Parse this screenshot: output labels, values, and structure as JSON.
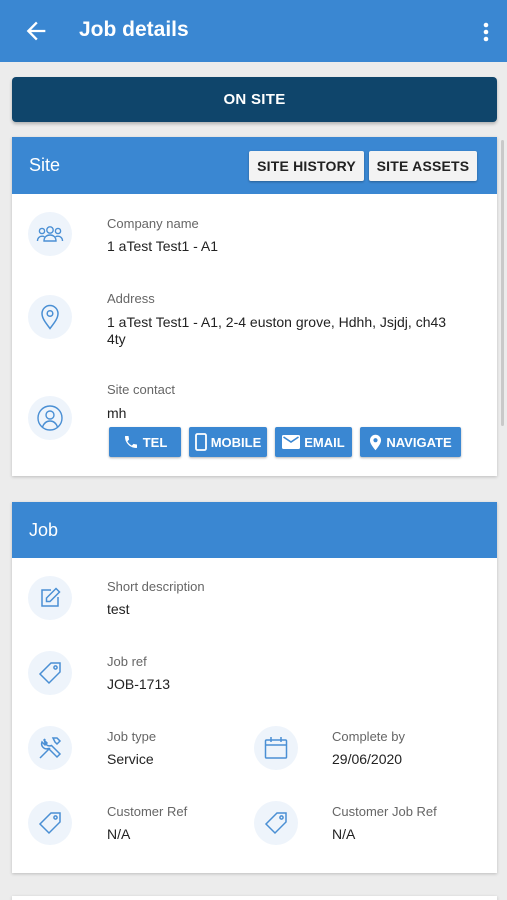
{
  "appbar": {
    "title": "Job details"
  },
  "status_button": {
    "label": "ON SITE"
  },
  "site": {
    "title": "Site",
    "history_label": "SITE HISTORY",
    "assets_label": "SITE ASSETS",
    "company_label": "Company name",
    "company_value": "1 aTest Test1 - A1",
    "address_label": "Address",
    "address_value": "1 aTest Test1 - A1, 2-4 euston grove, Hdhh, Jsjdj, ch43 4ty",
    "contact_label": "Site contact",
    "contact_value": "mh",
    "actions": {
      "tel": "TEL",
      "mobile": "MOBILE",
      "email": "EMAIL",
      "navigate": "NAVIGATE"
    }
  },
  "job": {
    "title": "Job",
    "short_desc_label": "Short description",
    "short_desc_value": "test",
    "job_ref_label": "Job ref",
    "job_ref_value": "JOB-1713",
    "job_type_label": "Job type",
    "job_type_value": "Service",
    "complete_by_label": "Complete by",
    "complete_by_value": "29/06/2020",
    "customer_ref_label": "Customer Ref",
    "customer_ref_value": "N/A",
    "customer_job_ref_label": "Customer Job Ref",
    "customer_job_ref_value": "N/A"
  },
  "colors": {
    "primary": "#3a87d2",
    "status": "#0f456b",
    "background": "#ececec",
    "icon_bg": "#eef4fb"
  }
}
